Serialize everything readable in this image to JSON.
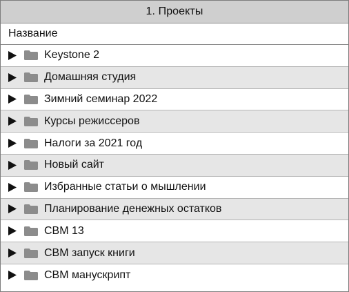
{
  "window": {
    "title": "1. Проекты"
  },
  "table": {
    "column_header": "Название",
    "icons": {
      "disclosure": "triangle-right-icon",
      "folder": "folder-icon"
    },
    "rows": [
      {
        "label": "Keystone 2"
      },
      {
        "label": "Домашняя студия"
      },
      {
        "label": "Зимний семинар 2022"
      },
      {
        "label": "Курсы режиссеров"
      },
      {
        "label": "Налоги за 2021 год"
      },
      {
        "label": "Новый сайт"
      },
      {
        "label": "Избранные статьи о мышлении"
      },
      {
        "label": "Планирование денежных остатков"
      },
      {
        "label": "CBM 13"
      },
      {
        "label": "CBM запуск книги"
      },
      {
        "label": "CBM манускрипт"
      }
    ]
  },
  "colors": {
    "title_bar_background": "#cfcfcf",
    "alternate_row_background": "#e6e6e6",
    "folder_icon": "#8c8c8c",
    "disclosure_icon": "#111111"
  }
}
